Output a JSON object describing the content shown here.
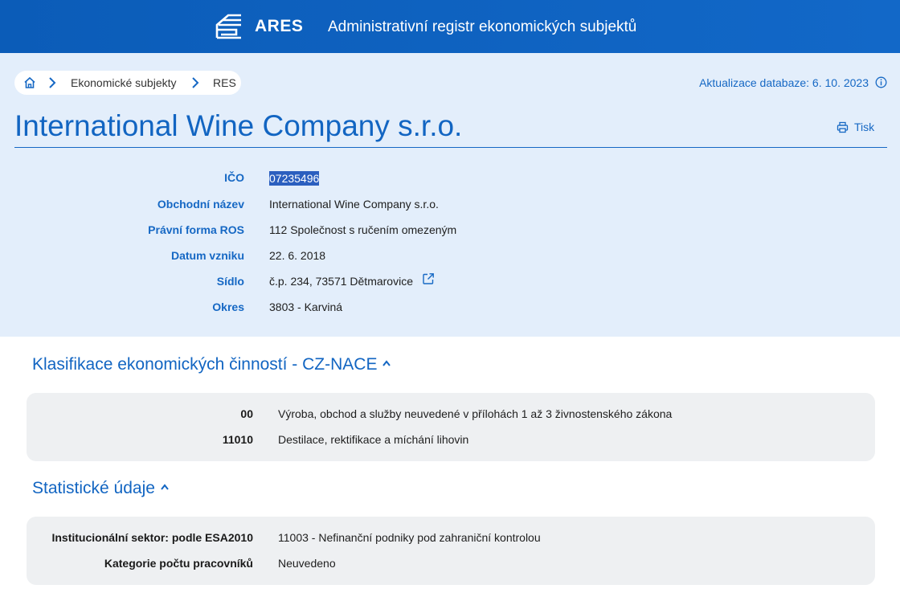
{
  "header": {
    "logo_text": "ARES",
    "app_title": "Administrativní registr ekonomických subjektů",
    "logo_icon": "ares-logo-icon"
  },
  "breadcrumb": {
    "home_icon": "home-icon",
    "items": [
      "Ekonomické subjekty",
      "RES"
    ]
  },
  "db_update": {
    "text": "Aktualizace databaze: 6. 10. 2023",
    "icon": "info-icon"
  },
  "company": {
    "name": "International Wine Company s.r.o."
  },
  "print": {
    "label": "Tisk",
    "icon": "printer-icon"
  },
  "details": [
    {
      "label": "IČO",
      "value": "07235496"
    },
    {
      "label": "Obchodní název",
      "value": "International Wine Company s.r.o."
    },
    {
      "label": "Právní forma ROS",
      "value": "112 Společnost s ručením omezeným"
    },
    {
      "label": "Datum vzniku",
      "value": "22. 6. 2018"
    },
    {
      "label": "Sídlo",
      "value": "č.p. 234, 73571 Dětmarovice"
    },
    {
      "label": "Okres",
      "value": "3803 - Karviná"
    }
  ],
  "nace": {
    "title": "Klasifikace ekonomických činností - CZ-NACE",
    "rows": [
      {
        "code": "00",
        "text": "Výroba, obchod a služby neuvedené v přílohách 1 až 3 živnostenského zákona"
      },
      {
        "code": "11010",
        "text": "Destilace, rektifikace a míchání lihovin"
      }
    ]
  },
  "stats": {
    "title": "Statistické údaje",
    "rows": [
      {
        "key": "Institucionální sektor: podle ESA2010",
        "value": "11003 - Nefinanční podniky pod zahraniční kontrolou"
      },
      {
        "key": "Kategorie počtu pracovníků",
        "value": "Neuvedeno"
      }
    ]
  },
  "colors": {
    "header_blue": "#0b5cb8",
    "accent_blue": "#1265c2",
    "hero_bg": "#e3eefb",
    "panel_bg": "#eef0f2",
    "selection": "#2b5fbf"
  }
}
